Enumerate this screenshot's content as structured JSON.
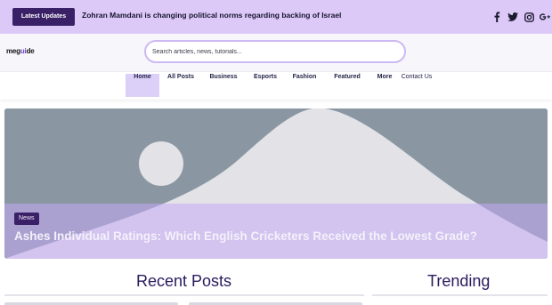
{
  "ticker": {
    "button_label": "Latest Updates",
    "headline": "Zohran Mamdani is changing political norms regarding backing of Israel"
  },
  "social": [
    "facebook-icon",
    "twitter-icon",
    "instagram-icon",
    "google-plus-icon"
  ],
  "header": {
    "logo_prefix": "meg",
    "logo_accent": "ui",
    "logo_suffix": "de",
    "search_placeholder": "Search articles, news, tutorials..."
  },
  "nav": {
    "items": [
      {
        "label": "Home",
        "active": true
      },
      {
        "label": "All Posts"
      },
      {
        "label": "Business"
      },
      {
        "label": "Esports"
      },
      {
        "label": "Fashion"
      },
      {
        "label": "Featured"
      },
      {
        "label": "More"
      },
      {
        "label": "Contact Us"
      }
    ]
  },
  "hero": {
    "category": "News",
    "title": "Ashes Individual Ratings: Which English Cricketers Received the Lowest Grade?"
  },
  "sections": {
    "recent": "Recent Posts",
    "trending": "Trending"
  },
  "colors": {
    "ticker_bg": "#ddc9f8",
    "accent_dark": "#3a2066",
    "nav_active": "#dcd0f8",
    "section_title": "#2a1a5e"
  }
}
